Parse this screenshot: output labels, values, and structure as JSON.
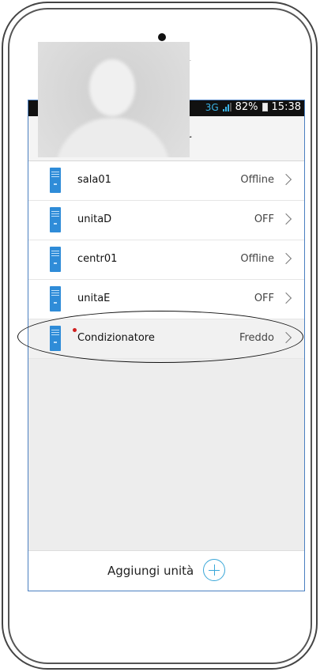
{
  "status_bar": {
    "network": "3G",
    "battery": "82%",
    "time": "15:38"
  },
  "header": {
    "title_fragment": "ir"
  },
  "units": [
    {
      "name": "sala01",
      "status": "Offline",
      "icon": "air-conditioner-unit-icon"
    },
    {
      "name": "unitaD",
      "status": "OFF",
      "icon": "air-conditioner-unit-icon"
    },
    {
      "name": "centr01",
      "status": "Offline",
      "icon": "air-conditioner-unit-icon"
    },
    {
      "name": "unitaE",
      "status": "OFF",
      "icon": "air-conditioner-unit-icon"
    },
    {
      "name": "Condizionatore",
      "status": "Freddo",
      "icon": "air-conditioner-unit-icon",
      "notification": true
    }
  ],
  "footer": {
    "add_label": "Aggiungi unità",
    "add_icon": "plus-circle-icon"
  },
  "colors": {
    "accent": "#2f8cd8",
    "plus_icon": "#3aa7d8",
    "notification_dot": "#d02020",
    "screen_border": "#4a7fc0"
  }
}
